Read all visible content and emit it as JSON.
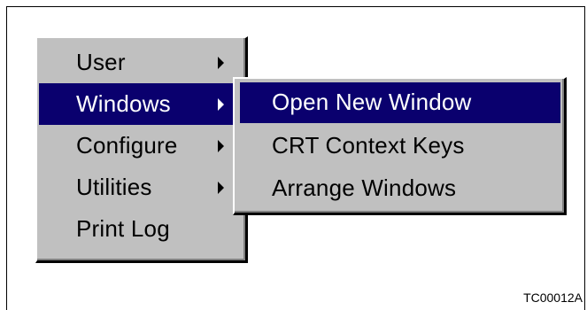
{
  "main_menu": {
    "items": [
      {
        "label": "User",
        "has_submenu": true,
        "selected": false
      },
      {
        "label": "Windows",
        "has_submenu": true,
        "selected": true
      },
      {
        "label": "Configure",
        "has_submenu": true,
        "selected": false
      },
      {
        "label": "Utilities",
        "has_submenu": true,
        "selected": false
      },
      {
        "label": "Print Log",
        "has_submenu": false,
        "selected": false
      }
    ]
  },
  "submenu": {
    "items": [
      {
        "label": "Open New Window",
        "selected": true
      },
      {
        "label": "CRT Context Keys",
        "selected": false
      },
      {
        "label": "Arrange Windows",
        "selected": false
      }
    ]
  },
  "figure_code": "TC00012A",
  "colors": {
    "menu_bg": "#c0c0c0",
    "highlight_bg": "#0a006e",
    "highlight_text": "#ffffff"
  },
  "icons": {
    "submenu_arrow": "triangle-right-icon"
  }
}
